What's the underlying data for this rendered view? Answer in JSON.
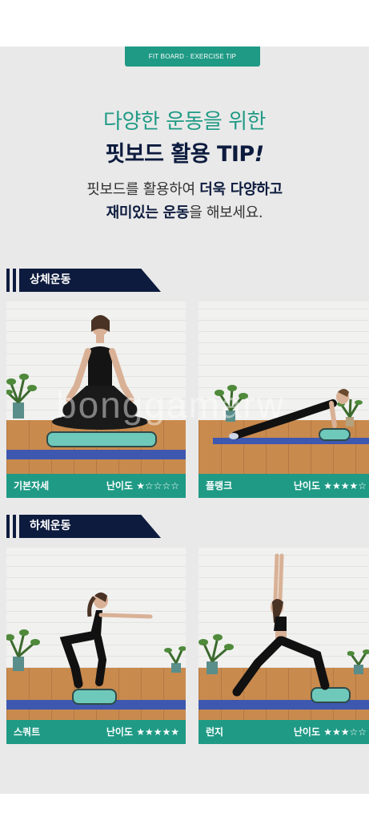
{
  "tag": "FIT BOARD · EXERCISE TIP",
  "headline": {
    "sub": "다양한 운동을 위한",
    "title_main": "핏보드 활용 TIP",
    "title_exclaim": "!"
  },
  "description": {
    "line1_plain": "핏보드를 활용하여 ",
    "line1_bold": "더욱 다양하고",
    "line2_bold": "재미있는 운동",
    "line2_plain": "을 해보세요."
  },
  "sections": [
    {
      "title": "상체운동",
      "cards": [
        {
          "name": "기본자세",
          "difficulty_label": "난이도",
          "stars": "★☆☆☆☆",
          "rating": 1
        },
        {
          "name": "플랭크",
          "difficulty_label": "난이도",
          "stars": "★★★★☆",
          "rating": 4
        }
      ]
    },
    {
      "title": "하체운동",
      "cards": [
        {
          "name": "스쿼트",
          "difficulty_label": "난이도",
          "stars": "★★★★★",
          "rating": 5
        },
        {
          "name": "런지",
          "difficulty_label": "난이도",
          "stars": "★★★☆☆",
          "rating": 3
        }
      ]
    }
  ],
  "watermark": "bonggamarw",
  "colors": {
    "accent": "#1f9a85",
    "navy": "#0d1b3e",
    "panel": "#e9e9e9"
  }
}
